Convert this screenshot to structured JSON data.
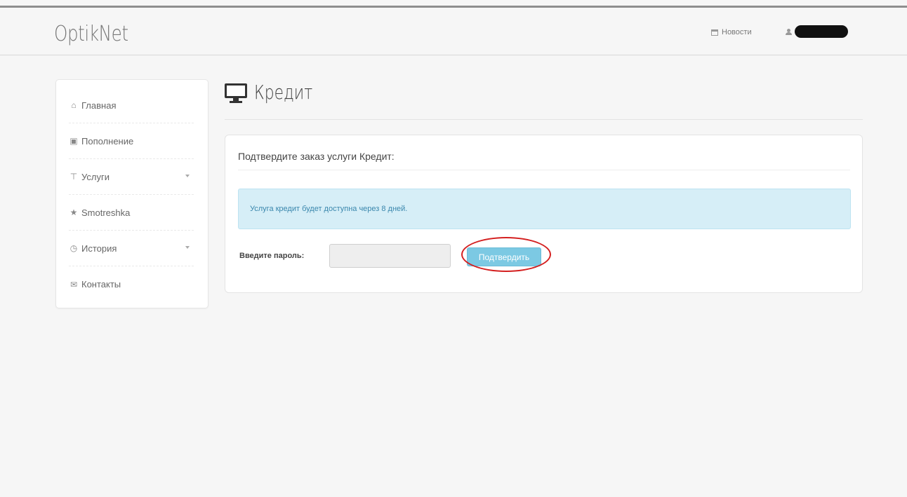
{
  "header": {
    "brand": "OptikNet",
    "news_label": "Новости",
    "user_name": ""
  },
  "sidebar": {
    "items": [
      {
        "label": "Главная",
        "icon": "home-icon",
        "has_caret": false
      },
      {
        "label": "Пополнение",
        "icon": "money-icon",
        "has_caret": false
      },
      {
        "label": "Услуги",
        "icon": "cart-icon",
        "has_caret": true
      },
      {
        "label": "Smotreshka",
        "icon": "star-icon",
        "has_caret": false
      },
      {
        "label": "История",
        "icon": "clock-icon",
        "has_caret": true
      },
      {
        "label": "Контакты",
        "icon": "envelope-icon",
        "has_caret": false
      }
    ]
  },
  "page": {
    "title": "Кредит",
    "title_icon": "monitor-icon"
  },
  "panel": {
    "heading": "Подтвердите заказ услуги Кредит:",
    "alert_text": "Услуга кредит будет доступна через 8 дней.",
    "password_label": "Введите пароль:",
    "password_value": "",
    "confirm_label": "Подтвердить"
  },
  "colors": {
    "alert_bg": "#d6eef7",
    "alert_text": "#3a87ad",
    "button_bg": "#7cc9e3",
    "highlight": "#d42020"
  }
}
